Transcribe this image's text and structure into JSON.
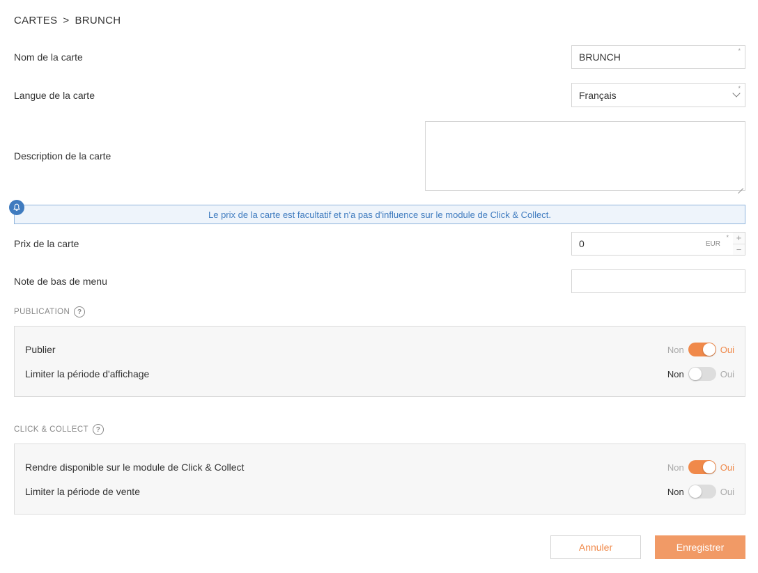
{
  "breadcrumb": {
    "parent": "CARTES",
    "separator": ">",
    "current": "BRUNCH"
  },
  "form": {
    "name": {
      "label": "Nom de la carte",
      "value": "BRUNCH",
      "required_mark": "*"
    },
    "language": {
      "label": "Langue de la carte",
      "value": "Français",
      "required_mark": "*"
    },
    "description": {
      "label": "Description de la carte",
      "value": ""
    },
    "info_message": "Le prix de la carte est facultatif et n'a pas d'influence sur le module de Click & Collect.",
    "price": {
      "label": "Prix de la carte",
      "value": "0",
      "currency": "EUR",
      "required_mark": "*",
      "plus": "+",
      "minus": "−"
    },
    "footer_note": {
      "label": "Note de bas de menu",
      "value": ""
    }
  },
  "publication": {
    "title": "PUBLICATION",
    "help": "?",
    "rows": [
      {
        "label": "Publier",
        "off": "Non",
        "on": "Oui",
        "enabled": true
      },
      {
        "label": "Limiter la période d'affichage",
        "off": "Non",
        "on": "Oui",
        "enabled": false
      }
    ]
  },
  "click_collect": {
    "title": "CLICK & COLLECT",
    "help": "?",
    "rows": [
      {
        "label": "Rendre disponible sur le module de Click & Collect",
        "off": "Non",
        "on": "Oui",
        "enabled": true
      },
      {
        "label": "Limiter la période de vente",
        "off": "Non",
        "on": "Oui",
        "enabled": false
      }
    ]
  },
  "actions": {
    "cancel": "Annuler",
    "save": "Enregistrer"
  },
  "colors": {
    "accent": "#f0894a",
    "info_text": "#3f7bbf",
    "info_bg": "#eef4fb"
  }
}
